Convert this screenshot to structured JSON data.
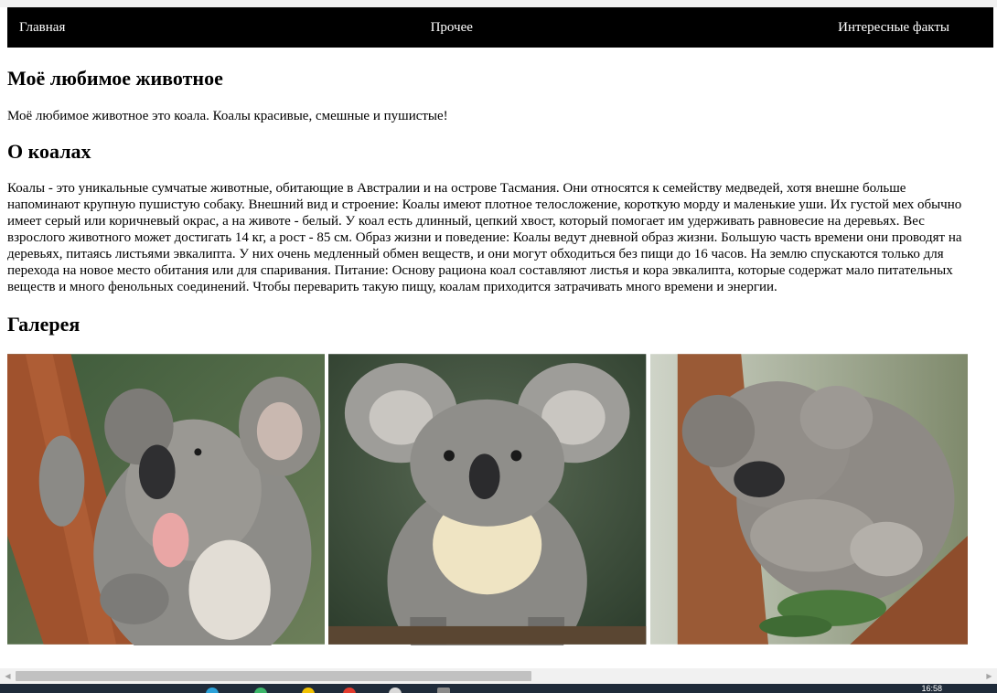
{
  "nav": {
    "home": "Главная",
    "other": "Прочее",
    "facts": "Интересные факты"
  },
  "page": {
    "title": "Моё любимое животное",
    "intro": "Моё любимое животное это коала. Коалы красивые, смешные и пушистые!"
  },
  "about": {
    "heading": "О коалах",
    "text": "Коалы - это уникальные сумчатые животные, обитающие в Австралии и на острове Тасмания. Они относятся к семейству медведей, хотя внешне больше напоминают крупную пушистую собаку. Внешний вид и строение: Коалы имеют плотное телосложение, короткую морду и маленькие уши. Их густой мех обычно имеет серый или коричневый окрас, а на животе - белый. У коал есть длинный, цепкий хвост, который помогает им удерживать равновесие на деревьях. Вес взрослого животного может достигать 14 кг, а рост - 85 см. Образ жизни и поведение: Коалы ведут дневной образ жизни. Большую часть времени они проводят на деревьях, питаясь листьями эвкалипта. У них очень медленный обмен веществ, и они могут обходиться без пищи до 16 часов. На землю спускаются только для перехода на новое место обитания или для спаривания. Питание: Основу рациона коал составляют листья и кора эвкалипта, которые содержат мало питательных веществ и много фенольных соединений. Чтобы переварить такую пищу, коалам приходится затрачивать много времени и энергии."
  },
  "gallery": {
    "heading": "Галерея",
    "images": [
      "koala-yawning-photo",
      "koala-front-photo",
      "koala-sleeping-photo"
    ]
  },
  "taskbar": {
    "clock": "16:58"
  }
}
